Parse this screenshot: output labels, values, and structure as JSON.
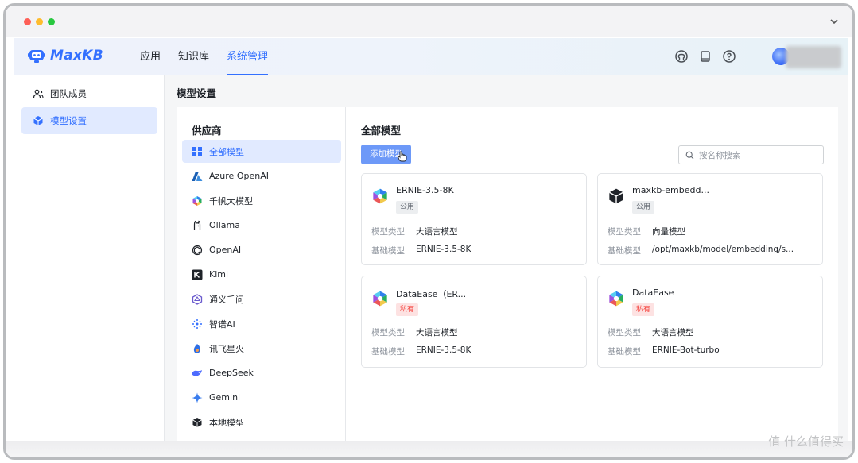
{
  "app": {
    "logo_text": "MaxKB",
    "nav": [
      "应用",
      "知识库",
      "系统管理"
    ],
    "nav_active": 2
  },
  "sidebar": {
    "items": [
      {
        "label": "团队成员",
        "icon": "team-users-icon"
      },
      {
        "label": "模型设置",
        "icon": "cube-icon"
      }
    ],
    "active": 1
  },
  "main": {
    "page_title": "模型设置",
    "providers": {
      "title": "供应商",
      "items": [
        {
          "label": "全部模型",
          "icon": "grid-icon"
        },
        {
          "label": "Azure OpenAI",
          "icon": "azure-icon"
        },
        {
          "label": "千帆大模型",
          "icon": "qianfan-icon"
        },
        {
          "label": "Ollama",
          "icon": "ollama-icon"
        },
        {
          "label": "OpenAI",
          "icon": "openai-icon"
        },
        {
          "label": "Kimi",
          "icon": "kimi-icon"
        },
        {
          "label": "通义千问",
          "icon": "tongyi-icon"
        },
        {
          "label": "智谱AI",
          "icon": "zhipu-icon"
        },
        {
          "label": "讯飞星火",
          "icon": "xunfei-icon"
        },
        {
          "label": "DeepSeek",
          "icon": "deepseek-icon"
        },
        {
          "label": "Gemini",
          "icon": "gemini-icon"
        },
        {
          "label": "本地模型",
          "icon": "local-cube-icon"
        }
      ],
      "active": 0
    },
    "models": {
      "title": "全部模型",
      "add_button": "添加模型",
      "search_placeholder": "按名称搜索",
      "type_label": "模型类型",
      "base_label": "基础模型",
      "cards": [
        {
          "name": "ERNIE-3.5-8K",
          "badge": "公用",
          "badge_kind": "public",
          "type": "大语言模型",
          "base": "ERNIE-3.5-8K",
          "icon": "qianfan-icon"
        },
        {
          "name": "maxkb-embedd...",
          "badge": "公用",
          "badge_kind": "public",
          "type": "向量模型",
          "base": "/opt/maxkb/model/embedding/s...",
          "icon": "local-cube-icon"
        },
        {
          "name": "DataEase（ER...",
          "badge": "私有",
          "badge_kind": "private",
          "type": "大语言模型",
          "base": "ERNIE-3.5-8K",
          "icon": "qianfan-icon"
        },
        {
          "name": "DataEase",
          "badge": "私有",
          "badge_kind": "private",
          "type": "大语言模型",
          "base": "ERNIE-Bot-turbo",
          "icon": "qianfan-icon"
        }
      ]
    }
  },
  "watermark": "值 什么值得买",
  "colors": {
    "accent": "#3370ff",
    "active_bg": "#e1eaff",
    "private_badge": "#f54a45"
  }
}
